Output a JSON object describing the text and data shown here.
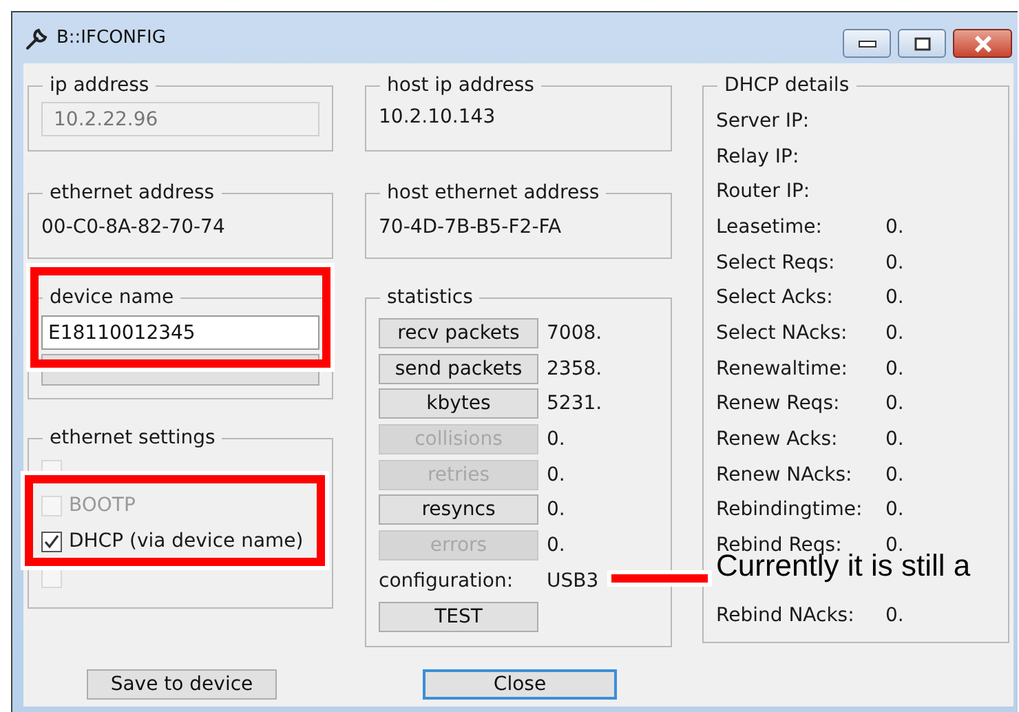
{
  "window": {
    "title": "B::IFCONFIG"
  },
  "ip_address": {
    "label": "ip address",
    "value": "10.2.22.96",
    "disabled": true
  },
  "ethernet_address": {
    "label": "ethernet address",
    "value": "00-C0-8A-82-70-74"
  },
  "device_name": {
    "label": "device name",
    "value": "E18110012345"
  },
  "ethernet_settings": {
    "label": "ethernet settings",
    "options": [
      {
        "checked": false,
        "disabled": true
      },
      {
        "label": "BOOTP",
        "checked": false,
        "disabled": true
      },
      {
        "label": "DHCP (via device name)",
        "checked": true,
        "disabled": false
      },
      {
        "checked": false,
        "disabled": true
      }
    ]
  },
  "host_ip_address": {
    "label": "host ip address",
    "value": "10.2.10.143"
  },
  "host_ethernet_address": {
    "label": "host ethernet address",
    "value": "70-4D-7B-B5-F2-FA"
  },
  "statistics": {
    "label": "statistics",
    "rows": [
      {
        "kind": "button",
        "label": "recv packets",
        "disabled": false,
        "value": "7008."
      },
      {
        "kind": "button",
        "label": "send packets",
        "disabled": false,
        "value": "2358."
      },
      {
        "kind": "button",
        "label": "kbytes",
        "disabled": false,
        "value": "5231."
      },
      {
        "kind": "button",
        "label": "collisions",
        "disabled": true,
        "value": "0."
      },
      {
        "kind": "button",
        "label": "retries",
        "disabled": true,
        "value": "0."
      },
      {
        "kind": "button",
        "label": "resyncs",
        "disabled": false,
        "value": "0."
      },
      {
        "kind": "button",
        "label": "errors",
        "disabled": true,
        "value": "0."
      },
      {
        "kind": "text",
        "label": "configuration:",
        "value": "USB3"
      },
      {
        "kind": "button",
        "label": "TEST",
        "disabled": false
      }
    ]
  },
  "dhcp_details": {
    "label": "DHCP details",
    "rows": [
      {
        "kind": "field",
        "label": "Server IP:"
      },
      {
        "kind": "field",
        "label": "Relay IP:"
      },
      {
        "kind": "field",
        "label": "Router IP:"
      },
      {
        "kind": "field",
        "label": "Leasetime:",
        "value": "0."
      },
      {
        "kind": "field",
        "label": "Select Reqs:",
        "value": "0."
      },
      {
        "kind": "field",
        "label": "Select Acks:",
        "value": "0."
      },
      {
        "kind": "field",
        "label": "Select NAcks:",
        "value": "0."
      },
      {
        "kind": "field",
        "label": "Renewaltime:",
        "value": "0."
      },
      {
        "kind": "field",
        "label": "Renew Reqs:",
        "value": "0."
      },
      {
        "kind": "field",
        "label": "Renew Acks:",
        "value": "0."
      },
      {
        "kind": "field",
        "label": "Renew NAcks:",
        "value": "0."
      },
      {
        "kind": "field",
        "label": "Rebindingtime:",
        "value": "0."
      },
      {
        "kind": "field",
        "label": "Rebind Reqs:",
        "value": "0."
      },
      {
        "kind": "covered"
      },
      {
        "kind": "field",
        "label": "Rebind NAcks:",
        "value": "0."
      }
    ]
  },
  "buttons": [
    {
      "label": "Save to device",
      "default": false
    },
    {
      "label": "Close",
      "default": true
    }
  ],
  "callout": {
    "text": "Currently it is still a"
  }
}
